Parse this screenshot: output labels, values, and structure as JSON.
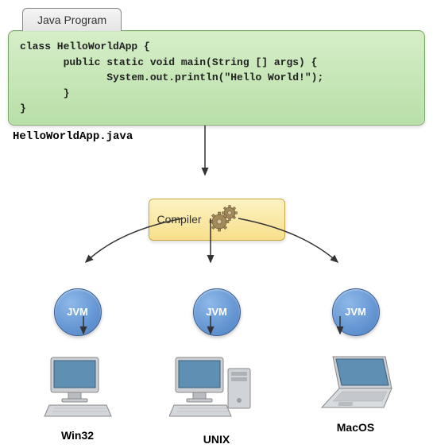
{
  "tab_label": "Java Program",
  "code": "class HelloWorldApp {\n       public static void main(String [] args) {\n              System.out.println(\"Hello World!\");\n       }\n}",
  "filename": "HelloWorldApp.java",
  "compiler": {
    "label": "Compiler"
  },
  "jvm_label": "JVM",
  "platforms": {
    "win32": "Win32",
    "unix": "UNIX",
    "macos": "MacOS"
  }
}
